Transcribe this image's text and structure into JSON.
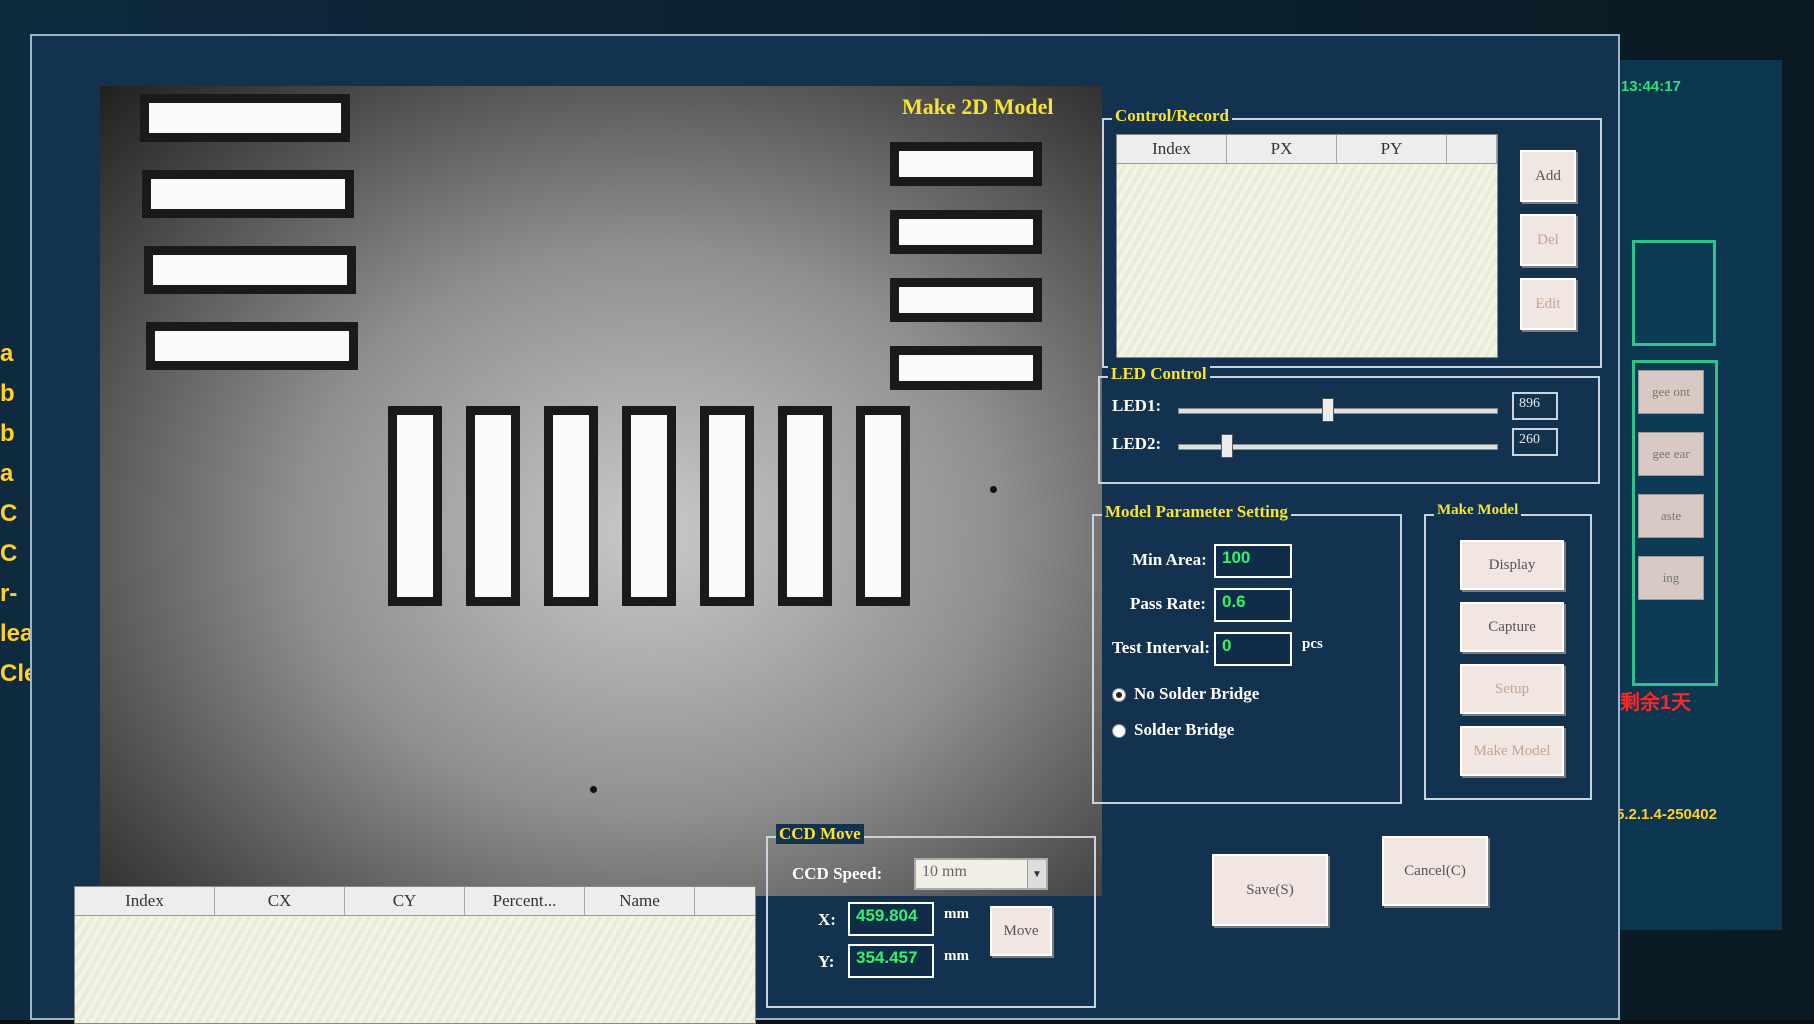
{
  "background": {
    "clock": "17  13:44:17",
    "remaining": "剩余1天",
    "version": "5.2.1.4-250402",
    "side_buttons": [
      "gee ont",
      "gee ear",
      "aste",
      "ing"
    ],
    "left_fragments": [
      "a",
      "b",
      "b",
      "a",
      "C",
      "C",
      "r-",
      "lea",
      "Cle"
    ]
  },
  "dialog": {
    "title": "Make 2D Model"
  },
  "result_table": {
    "columns": [
      "Index",
      "CX",
      "CY",
      "Percent...",
      "Name"
    ]
  },
  "control_record": {
    "title": "Control/Record",
    "columns": [
      "Index",
      "PX",
      "PY"
    ],
    "buttons": {
      "add": "Add",
      "del": "Del",
      "edit": "Edit"
    }
  },
  "led_control": {
    "title": "LED Control",
    "led1": {
      "label": "LED1:",
      "value": "896",
      "level": 0.47
    },
    "led2": {
      "label": "LED2:",
      "value": "260",
      "level": 0.15
    }
  },
  "model_params": {
    "title": "Model Parameter Setting",
    "min_area": {
      "label": "Min Area:",
      "value": "100"
    },
    "pass_rate": {
      "label": "Pass Rate:",
      "value": "0.6"
    },
    "test_interval": {
      "label": "Test Interval:",
      "value": "0",
      "unit": "pcs"
    },
    "radio_no_bridge": "No Solder Bridge",
    "radio_bridge": "Solder Bridge"
  },
  "make_model": {
    "title": "Make Model",
    "display": "Display",
    "capture": "Capture",
    "setup": "Setup",
    "make_model": "Make Model"
  },
  "ccd_move": {
    "title": "CCD Move",
    "speed_label": "CCD Speed:",
    "speed_value": "10 mm",
    "x_label": "X:",
    "x_value": "459.804",
    "y_label": "Y:",
    "y_value": "354.457",
    "unit": "mm",
    "move": "Move"
  },
  "footer": {
    "save": "Save(S)",
    "cancel": "Cancel(C)"
  }
}
